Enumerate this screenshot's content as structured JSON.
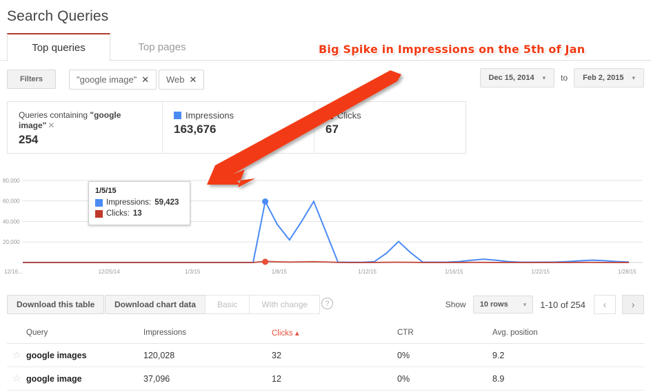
{
  "page_title": "Search Queries",
  "tabs": [
    {
      "label": "Top queries",
      "active": true
    },
    {
      "label": "Top pages",
      "active": false
    }
  ],
  "filters": {
    "filters_button": "Filters",
    "chips": [
      {
        "label": "\"google image\"",
        "remove": "✕"
      },
      {
        "label": "Web",
        "remove": "✕"
      }
    ],
    "date_from": "Dec 15, 2014",
    "date_to": "Feb 2, 2015",
    "to_label": "to",
    "caret": "▾"
  },
  "cards": {
    "queries": {
      "label_prefix": "Queries containing ",
      "label_query": "\"google image\"",
      "remove": "✕",
      "value": "254"
    },
    "impressions": {
      "label": "Impressions",
      "value": "163,676",
      "color": "#4a8bf4"
    },
    "clicks": {
      "label": "Clicks",
      "value": "67",
      "color": "#c0392b"
    }
  },
  "annotation": {
    "text": "Big Spike in Impressions on the 5th of Jan",
    "color": "#f23b14"
  },
  "tooltip": {
    "date": "1/5/15",
    "impressions_label": "Impressions:",
    "impressions_value": "59,423",
    "clicks_label": "Clicks:",
    "clicks_value": "13"
  },
  "chart_data": {
    "type": "line",
    "title": "",
    "xlabel": "",
    "ylabel": "",
    "ylim": [
      0,
      90000
    ],
    "grid": true,
    "legend_position": "top",
    "y_ticks": [
      "20,000",
      "40,000",
      "60,000",
      "80,000"
    ],
    "y_tick_values": [
      20000,
      40000,
      60000,
      80000
    ],
    "x_ticks": [
      "12/16...",
      "12/25/14",
      "1/3/15",
      "1/8/15",
      "1/12/15",
      "1/16/15",
      "1/22/15",
      "1/28/15"
    ],
    "highlight_point": {
      "x": "1/5/15",
      "impressions": 59423,
      "clicks": 13
    },
    "series": [
      {
        "name": "Impressions",
        "color": "#4a8bf4",
        "values": [
          0,
          0,
          0,
          0,
          0,
          0,
          0,
          0,
          0,
          0,
          0,
          0,
          0,
          0,
          0,
          0,
          0,
          0,
          0,
          0,
          59423,
          37000,
          22000,
          40000,
          59500,
          30000,
          300,
          200,
          200,
          800,
          9000,
          20500,
          9500,
          300,
          250,
          300,
          900,
          2200,
          3200,
          2300,
          900,
          300,
          250,
          300,
          400,
          900,
          1700,
          2300,
          1800,
          900,
          400
        ]
      },
      {
        "name": "Clicks",
        "color": "#c0392b",
        "values": [
          0,
          0,
          0,
          0,
          0,
          0,
          0,
          0,
          0,
          0,
          0,
          0,
          0,
          0,
          0,
          0,
          0,
          0,
          0,
          0,
          13,
          8,
          5,
          7,
          9,
          6,
          1,
          0,
          0,
          0,
          2,
          3,
          2,
          0,
          0,
          0,
          0,
          1,
          1,
          0,
          0,
          0,
          0,
          0,
          0,
          0,
          1,
          1,
          0,
          0,
          0
        ]
      }
    ]
  },
  "toolbar": {
    "download_table": "Download this table",
    "download_chart": "Download chart data",
    "segment_basic": "Basic",
    "segment_with_change": "With change",
    "help": "?",
    "show_label": "Show",
    "rows_value": "10 rows",
    "rows_caret": "▾",
    "range_text": "1-10 of 254",
    "prev": "‹",
    "next": "›"
  },
  "table": {
    "columns": [
      {
        "label": "Query",
        "sorted": false
      },
      {
        "label": "Impressions",
        "sorted": false
      },
      {
        "label": "Clicks ▴",
        "sorted": true
      },
      {
        "label": "CTR",
        "sorted": false
      },
      {
        "label": "Avg. position",
        "sorted": false
      }
    ],
    "rows": [
      {
        "star": "☆",
        "query": "google images",
        "impressions": "120,028",
        "clicks": "32",
        "ctr": "0%",
        "position": "9.2"
      },
      {
        "star": "☆",
        "query": "google image",
        "impressions": "37,096",
        "clicks": "12",
        "ctr": "0%",
        "position": "8.9"
      }
    ]
  }
}
